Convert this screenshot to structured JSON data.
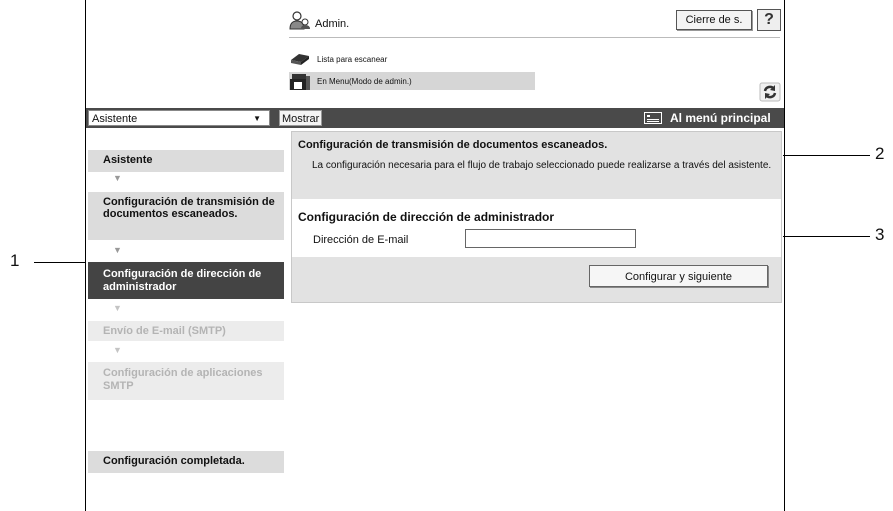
{
  "header": {
    "admin_label": "Admin.",
    "logout_label": "Cierre de s.",
    "help_label": "?",
    "scan_list_label": "Lista para escanear",
    "menu_label": "En Menu(Modo de admin.)"
  },
  "navbar": {
    "select_value": "Asistente",
    "show_label": "Mostrar",
    "main_menu_label": "Al menú principal"
  },
  "sidebar": {
    "steps": [
      {
        "label": "Asistente",
        "state": "normal"
      },
      {
        "label": "Configuración de transmisión de documentos escaneados.",
        "state": "normal"
      },
      {
        "label": "Configuración de dirección de administrador",
        "state": "active"
      },
      {
        "label": "Envío de E-mail (SMTP)",
        "state": "disabled"
      },
      {
        "label": "Configuración de aplicaciones SMTP",
        "state": "disabled"
      },
      {
        "label": "Configuración completada.",
        "state": "normal"
      }
    ]
  },
  "main": {
    "section1_title": "Configuración de transmisión de documentos escaneados.",
    "section1_desc": "La configuración necesaria para el flujo de trabajo seleccionado puede realizarse a través del asistente.",
    "section2_title": "Configuración de dirección de administrador",
    "email_label": "Dirección de E-mail",
    "email_value": "",
    "submit_label": "Configurar y siguiente"
  },
  "callouts": [
    "1",
    "2",
    "3"
  ]
}
